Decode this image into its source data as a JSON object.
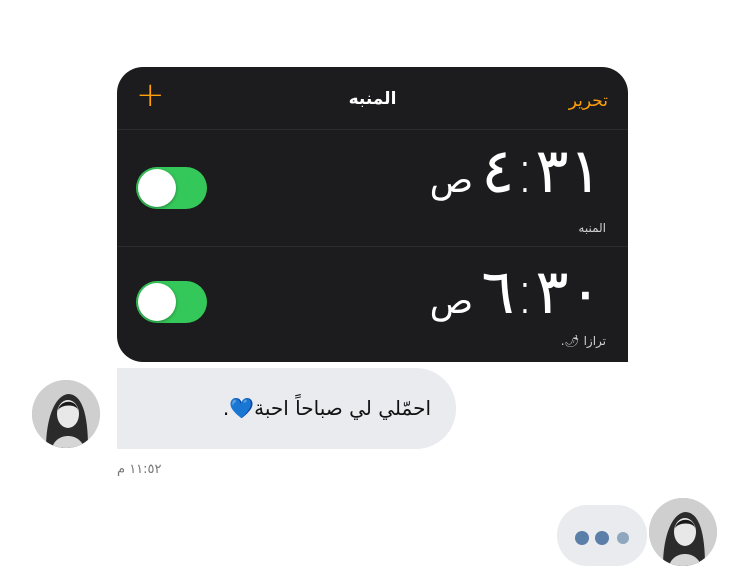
{
  "alarm_screenshot": {
    "title": "المنبه",
    "edit_label": "تحرير",
    "add_symbol": "+",
    "accent_color": "#ff9f0a",
    "toggle_color": "#34c759",
    "alarms": [
      {
        "time": "٤:٣١",
        "period": "ص",
        "label": "المنبه",
        "enabled": true
      },
      {
        "time": "٦:٣٠",
        "period": "ص",
        "label": "ترازا 🌶.",
        "enabled": true
      }
    ]
  },
  "message": {
    "text": "احمّلي لي صباحاً احبة",
    "emoji": "💙",
    "suffix": "."
  },
  "timestamp": "١١:٥٢ م",
  "typing_indicator": {
    "icon": "typing-dots-icon"
  }
}
